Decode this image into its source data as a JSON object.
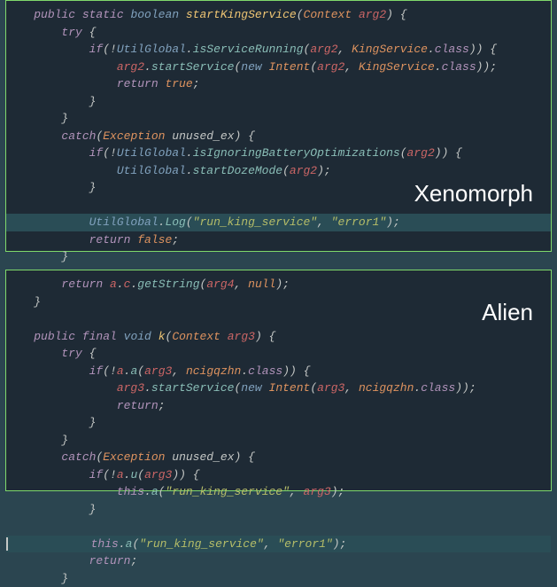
{
  "xenomorph": {
    "label": "Xenomorph",
    "code": {
      "l1": {
        "mods": "public static",
        "rettype": "boolean",
        "name": "startKingService",
        "ptype": "Context",
        "pname": "arg2"
      },
      "l2": {
        "kw": "try"
      },
      "l3": {
        "kw": "if",
        "neg": "!",
        "cls": "UtilGlobal",
        "method": "isServiceRunning",
        "arg": "arg2",
        "svc": "KingService",
        "classkw": "class"
      },
      "l4": {
        "arg": "arg2",
        "method": "startService",
        "newkw": "new",
        "intent": "Intent",
        "svc": "KingService",
        "classkw": "class"
      },
      "l5": {
        "kw": "return",
        "val": "true"
      },
      "l6": {
        "kw": "catch",
        "type": "Exception",
        "name": "unused_ex"
      },
      "l7": {
        "kw": "if",
        "neg": "!",
        "cls": "UtilGlobal",
        "method": "isIgnoringBatteryOptimizations",
        "arg": "arg2"
      },
      "l8": {
        "cls": "UtilGlobal",
        "method": "startDozeMode",
        "arg": "arg2"
      },
      "l9": {
        "cls": "UtilGlobal",
        "method": "Log",
        "s1": "\"run_king_service\"",
        "s2": "\"error1\""
      },
      "l10": {
        "kw": "return",
        "val": "false"
      },
      "l11": {
        "kw": "return",
        "val": "false"
      }
    }
  },
  "alien": {
    "label": "Alien",
    "code": {
      "l0": {
        "kw": "return",
        "obj": "a",
        "c": "c",
        "method": "getString",
        "arg": "arg4",
        "null": "null"
      },
      "l1": {
        "mods": "public final",
        "rettype": "void",
        "name": "k",
        "ptype": "Context",
        "pname": "arg3"
      },
      "l2": {
        "kw": "try"
      },
      "l3": {
        "kw": "if",
        "neg": "!",
        "obj": "a",
        "method": "a",
        "arg": "arg3",
        "svc": "ncigqzhn",
        "classkw": "class"
      },
      "l4": {
        "arg": "arg3",
        "method": "startService",
        "newkw": "new",
        "intent": "Intent",
        "svc": "ncigqzhn",
        "classkw": "class"
      },
      "l5": {
        "kw": "return"
      },
      "l6": {
        "kw": "catch",
        "type": "Exception",
        "name": "unused_ex"
      },
      "l7": {
        "kw": "if",
        "neg": "!",
        "obj": "a",
        "method": "u",
        "arg": "arg3"
      },
      "l8": {
        "this": "this",
        "method": "a",
        "s1": "\"run_king_service\"",
        "arg": "arg3"
      },
      "l9": {
        "this": "this",
        "method": "a",
        "s1": "\"run_king_service\"",
        "s2": "\"error1\""
      },
      "l10": {
        "kw": "return"
      }
    }
  }
}
